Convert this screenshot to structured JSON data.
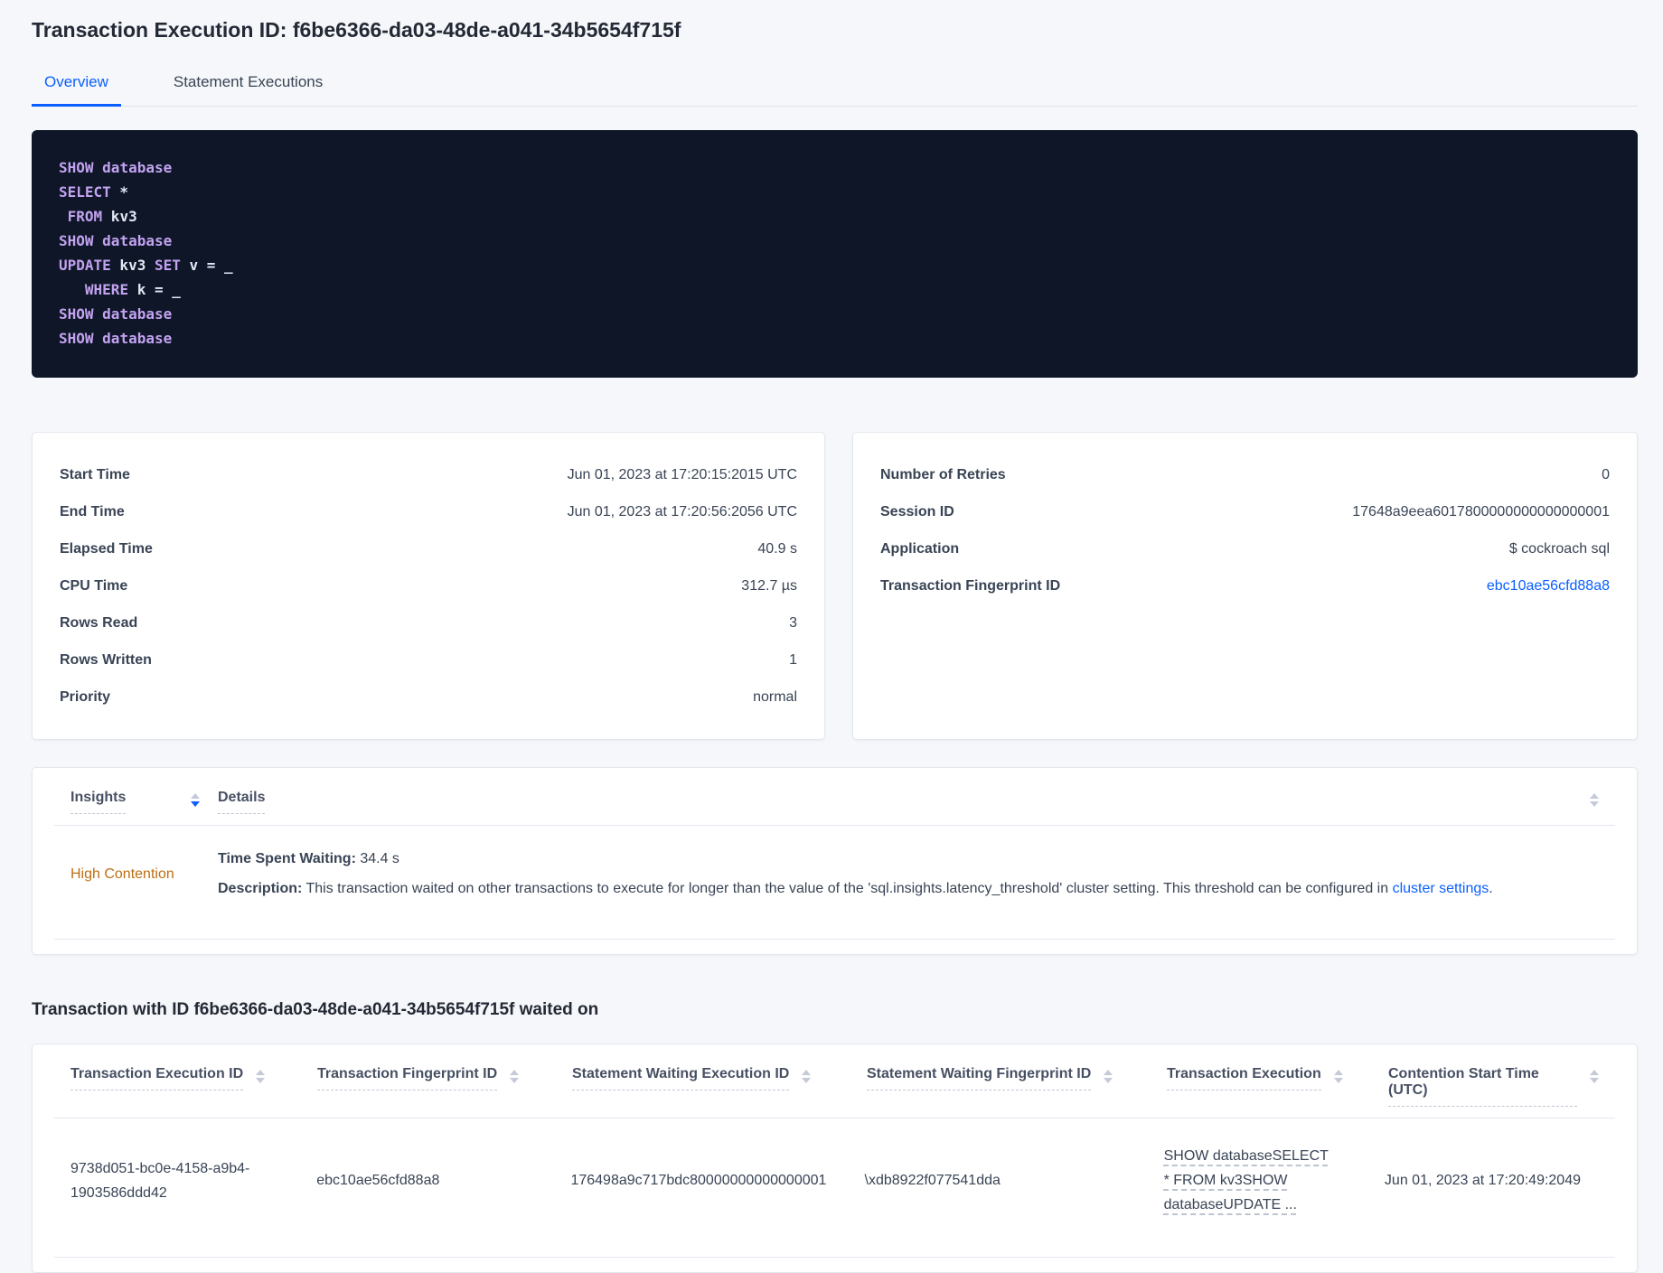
{
  "header": {
    "title": "Transaction Execution ID: f6be6366-da03-48de-a041-34b5654f715f"
  },
  "tabs": [
    {
      "label": "Overview"
    },
    {
      "label": "Statement Executions"
    }
  ],
  "colors": {
    "accent_blue": "#0b5fff",
    "insight_orange": "#bd6e13",
    "code_background": "#0e1628",
    "code_keyword": "#c3a2f0",
    "code_plain": "#e4e8f4"
  },
  "sql_box": {
    "lines": [
      [
        [
          "kw",
          "SHOW"
        ],
        [
          "pl",
          " "
        ],
        [
          "kw",
          "database"
        ]
      ],
      [
        [
          "kw",
          "SELECT"
        ],
        [
          "pl",
          " *"
        ]
      ],
      [
        [
          "pl",
          " "
        ],
        [
          "kw",
          "FROM"
        ],
        [
          "pl",
          " kv3"
        ]
      ],
      [
        [
          "kw",
          "SHOW"
        ],
        [
          "pl",
          " "
        ],
        [
          "kw",
          "database"
        ]
      ],
      [
        [
          "kw",
          "UPDATE"
        ],
        [
          "pl",
          " kv3 "
        ],
        [
          "kw",
          "SET"
        ],
        [
          "pl",
          " v = _"
        ]
      ],
      [
        [
          "pl",
          "   "
        ],
        [
          "kw",
          "WHERE"
        ],
        [
          "pl",
          " k = _"
        ]
      ],
      [
        [
          "kw",
          "SHOW"
        ],
        [
          "pl",
          " "
        ],
        [
          "kw",
          "database"
        ]
      ],
      [
        [
          "kw",
          "SHOW"
        ],
        [
          "pl",
          " "
        ],
        [
          "kw",
          "database"
        ]
      ]
    ]
  },
  "summary_left": {
    "rows": [
      {
        "label": "Start Time",
        "value": "Jun 01, 2023 at 17:20:15:2015 UTC"
      },
      {
        "label": "End Time",
        "value": "Jun 01, 2023 at 17:20:56:2056 UTC"
      },
      {
        "label": "Elapsed Time",
        "value": "40.9 s"
      },
      {
        "label": "CPU Time",
        "value": "312.7 µs"
      },
      {
        "label": "Rows Read",
        "value": "3"
      },
      {
        "label": "Rows Written",
        "value": "1"
      },
      {
        "label": "Priority",
        "value": "normal"
      }
    ]
  },
  "summary_right": {
    "rows": [
      {
        "label": "Number of Retries",
        "value": "0"
      },
      {
        "label": "Session ID",
        "value": "17648a9eea6017800000000000000001"
      },
      {
        "label": "Application",
        "value": "$ cockroach sql"
      },
      {
        "label": "Transaction Fingerprint ID",
        "value": "ebc10ae56cfd88a8",
        "link": true
      }
    ]
  },
  "insights_table": {
    "columns": [
      "Insights",
      "Details"
    ],
    "row": {
      "insight": "High Contention",
      "waiting_label": "Time Spent Waiting:",
      "waiting_value": " 34.4 s",
      "description_label": "Description:",
      "description_text": " This transaction waited on other transactions to execute for longer than the value of the 'sql.insights.latency_threshold' cluster setting. This threshold can be configured in ",
      "link_text": "cluster settings",
      "after_link": "."
    }
  },
  "waited_section": {
    "heading": "Transaction with ID f6be6366-da03-48de-a041-34b5654f715f waited on",
    "columns": [
      "Transaction Execution ID",
      "Transaction Fingerprint ID",
      "Statement Waiting Execution ID",
      "Statement Waiting Fingerprint ID",
      "Transaction Execution",
      "Contention Start Time (UTC)"
    ],
    "row": {
      "txn_execution_id": "9738d051-bc0e-4158-a9b4-1903586ddd42",
      "txn_fingerprint_id": "ebc10ae56cfd88a8",
      "stmt_waiting_execution_id": "176498a9c717bdc80000000000000001",
      "stmt_waiting_fingerprint_id": "\\xdb8922f077541dda",
      "transaction_execution": "SHOW databaseSELECT * FROM kv3SHOW databaseUPDATE ...",
      "contention_start_time": "Jun 01, 2023 at 17:20:49:2049"
    }
  }
}
